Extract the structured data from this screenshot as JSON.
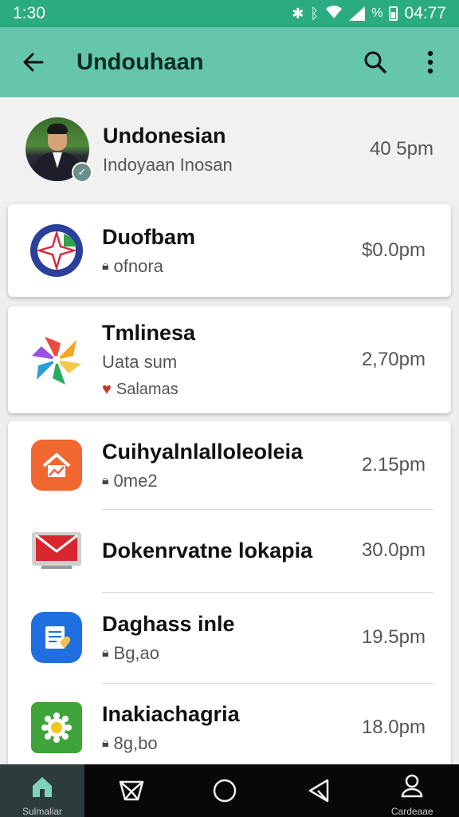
{
  "status_bar": {
    "time_left": "1:30",
    "time_right": "04:77",
    "icons": [
      "nfc-icon",
      "bluetooth-icon",
      "wifi-icon",
      "signal-icon",
      "battery-icon"
    ],
    "extra_symbol": "%"
  },
  "app_bar": {
    "title": "Undouhaan",
    "back_icon": "arrow-left-icon",
    "search_icon": "search-icon",
    "menu_icon": "more-vertical-icon",
    "color": "#66c6ab"
  },
  "conversations": [
    {
      "title": "Undonesian",
      "subtitle": "Indoyaan Inosan",
      "time": "40 5pm",
      "avatar": "profile-photo"
    },
    {
      "title": "Duofbam",
      "subtitle": "ofnora",
      "time": "$0.0pm",
      "icon": "star-compass-icon"
    },
    {
      "title": "Tmlinesa",
      "subtitle": "Uata sum",
      "subtitle2": "Salamas",
      "time": "2,70pm",
      "icon": "pinwheel-icon"
    },
    {
      "title": "Cuihyalnlalloleoleia",
      "subtitle": "0me2",
      "time": "2.15pm",
      "icon": "home-icon"
    },
    {
      "title": "Dokenrvatne lokapia",
      "subtitle": "",
      "time": "30.0pm",
      "icon": "mail-icon"
    },
    {
      "title": "Daghass inle",
      "subtitle": "Bg,ao",
      "time": "19.5pm",
      "icon": "notes-icon"
    },
    {
      "title": "Inakiachagria",
      "subtitle": "8g,bo",
      "time": "18.0pm",
      "icon": "sun-gear-icon"
    }
  ],
  "bottom_nav": [
    {
      "label": "Sulmaliar",
      "icon": "home-icon",
      "active": true
    },
    {
      "label": "",
      "icon": "cup-icon",
      "active": false
    },
    {
      "label": "",
      "icon": "circle-icon",
      "active": false
    },
    {
      "label": "",
      "icon": "triangle-back-icon",
      "active": false
    },
    {
      "label": "Cardeaae",
      "icon": "person-icon",
      "active": false
    }
  ],
  "colors": {
    "status_bar": "#2bab80",
    "app_bar": "#66c6ab",
    "bottom_nav": "#080808",
    "nav_active": "#2d3b3d"
  }
}
